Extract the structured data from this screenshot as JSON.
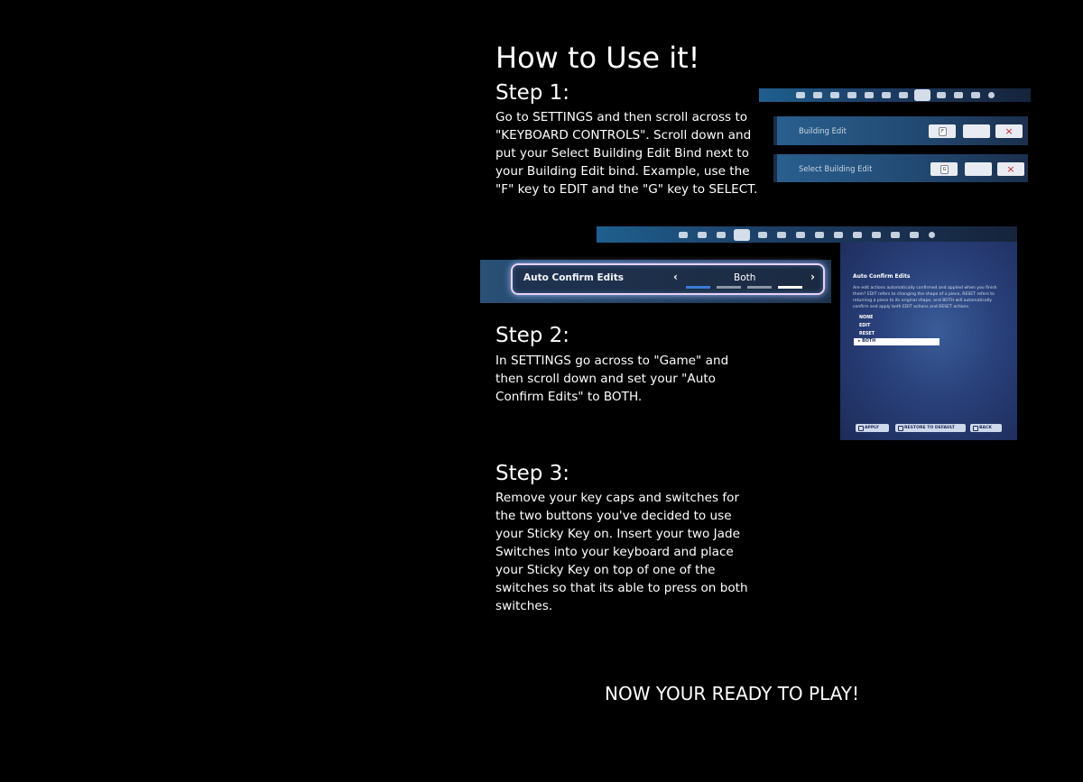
{
  "title": "How to Use it!",
  "step1": {
    "heading": "Step 1:",
    "lines": [
      "Go to SETTINGS and then scroll across to",
      "\"KEYBOARD CONTROLS\". Scroll down and",
      "put your Select Building Edit Bind next to",
      "your Building Edit bind. Example, use the",
      "\"F\" key to EDIT and the \"G\" key to SELECT."
    ],
    "bindings": [
      {
        "label": "Building Edit",
        "key": "F"
      },
      {
        "label": "Select Building Edit",
        "key": "G"
      }
    ],
    "remove_icon": "×"
  },
  "step2": {
    "heading": "Step 2:",
    "lines": [
      "In SETTINGS go across to \"Game\" and",
      "then scroll down and set your \"Auto",
      "Confirm Edits\" to BOTH."
    ],
    "setting_label": "Auto Confirm Edits",
    "setting_value": "Both",
    "level": {
      "selected_index": 3,
      "total": 4
    },
    "panel": {
      "title": "Auto Confirm Edits",
      "description": "Are edit actions automatically confirmed and applied when you finish them? EDIT refers to changing the shape of a piece, RESET refers to returning a piece to its original shape, and BOTH will automatically confirm and apply both EDIT actions and RESET actions.",
      "options": [
        "NONE",
        "EDIT",
        "RESET",
        "BOTH"
      ],
      "selected_option": "BOTH",
      "buttons": [
        "APPLY",
        "RESTORE TO DEFAULT",
        "BACK"
      ]
    }
  },
  "step3": {
    "heading": "Step 3:",
    "lines": [
      "Remove your key caps and switches for",
      "the two buttons you've decided to use",
      "your Sticky Key on. Insert your two Jade",
      "Switches into your keyboard and place",
      "your Sticky Key on top of one of the",
      "switches so that its able to press on both",
      "switches."
    ]
  },
  "final": "NOW YOUR READY TO PLAY!",
  "colors": {
    "background": "#000000",
    "text": "#ffffff",
    "remove": "#c2252b",
    "level_active": "#3a7bd5"
  }
}
